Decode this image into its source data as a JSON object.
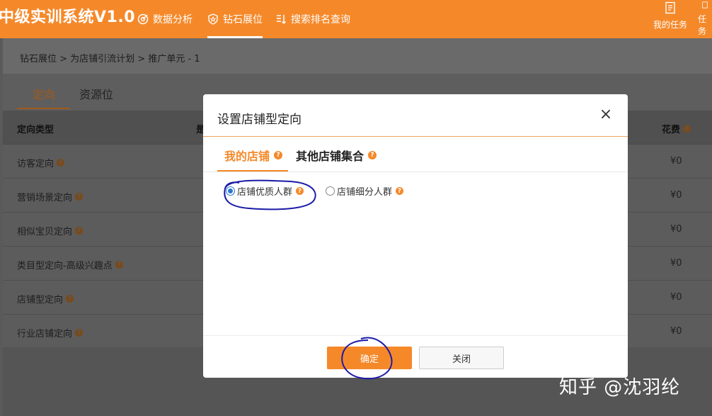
{
  "header": {
    "title": "中级实训系统V1.0",
    "nav": [
      {
        "label": "数据分析",
        "icon": "target-icon"
      },
      {
        "label": "钻石展位",
        "icon": "badge-icon"
      },
      {
        "label": "搜索排名查询",
        "icon": "ranking-icon"
      }
    ],
    "my_tasks": "我的任务",
    "tasks_partial": "任务"
  },
  "breadcrumb": "钻石展位 > 为店铺引流计划 > 推广单元 - 1",
  "page_tabs": [
    "定向",
    "资源位"
  ],
  "table": {
    "headers": {
      "type": "定向类型",
      "second_partial": "是",
      "cost": "花费"
    },
    "rows": [
      {
        "type": "访客定向",
        "cost": "¥0"
      },
      {
        "type": "营销场景定向",
        "cost": "¥0"
      },
      {
        "type": "相似宝贝定向",
        "cost": "¥0"
      },
      {
        "type": "类目型定向-高级兴趣点",
        "cost": "¥0"
      },
      {
        "type": "店铺型定向",
        "cost": "¥0"
      },
      {
        "type": "行业店铺定向",
        "cost": "¥0"
      }
    ]
  },
  "modal": {
    "title": "设置店铺型定向",
    "close_glyph": "×",
    "tabs": [
      "我的店铺",
      "其他店铺集合"
    ],
    "options": [
      {
        "label": "店铺优质人群",
        "selected": true
      },
      {
        "label": "店铺细分人群",
        "selected": false
      }
    ],
    "ok_label": "确定",
    "close_label": "关闭"
  },
  "watermark": "知乎 @沈羽纶",
  "colors": {
    "accent": "#f5892a",
    "annotation": "#1a1aa8"
  }
}
